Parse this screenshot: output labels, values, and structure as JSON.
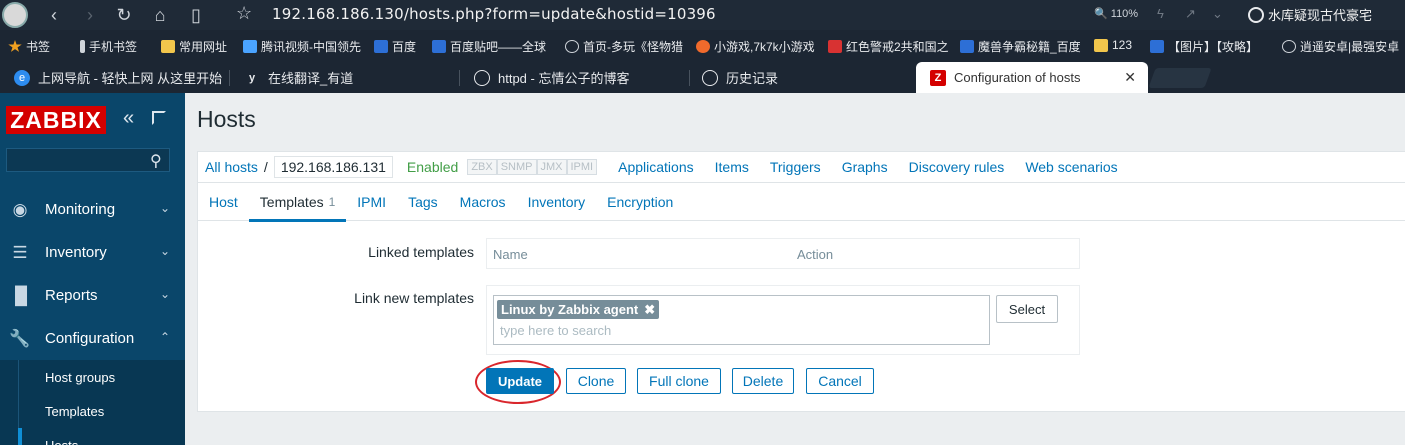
{
  "browser": {
    "url": "192.168.186.130/hosts.php?form=update&hostid=10396",
    "zoom": "110%",
    "search_engine_label": "水库疑现古代豪宅",
    "icons": [
      "avatar",
      "back-icon",
      "forward-icon",
      "reload-icon",
      "home-icon",
      "reader-icon",
      "bookmark-star-icon"
    ]
  },
  "bookmarks": [
    {
      "label": "书签",
      "color": "#f0a020"
    },
    {
      "label": "手机书签",
      "color": "#cfd4da"
    },
    {
      "label": "常用网址",
      "color": "#f2c64c"
    },
    {
      "label": "腾讯视频-中国领先",
      "color": "#4aa3ff"
    },
    {
      "label": "百度",
      "color": "#2d6fd6"
    },
    {
      "label": "百度贴吧——全球",
      "color": "#2d6fd6"
    },
    {
      "label": "首页-多玩《怪物猎",
      "color": "#cfd4da"
    },
    {
      "label": "小游戏,7k7k小游戏",
      "color": "#f06a2c"
    },
    {
      "label": "红色警戒2共和国之",
      "color": "#d83232"
    },
    {
      "label": "魔兽争霸秘籍_百度",
      "color": "#2d6fd6"
    },
    {
      "label": "123",
      "color": "#f2c64c"
    },
    {
      "label": "【图片】【攻略】",
      "color": "#2d6fd6"
    },
    {
      "label": "逍遥安卓|最强安卓",
      "color": "#cfd4da"
    }
  ],
  "tabs": [
    {
      "label": "上网导航 - 轻快上网 从这里开始"
    },
    {
      "label": "在线翻译_有道"
    },
    {
      "label": "httpd - 忘情公子的博客"
    },
    {
      "label": "历史记录"
    },
    {
      "label": "Configuration of hosts",
      "close": "✕"
    }
  ],
  "sidebar": {
    "logo": "ZABBIX",
    "menu": [
      {
        "label": "Monitoring",
        "icon": "eye-icon"
      },
      {
        "label": "Inventory",
        "icon": "list-icon"
      },
      {
        "label": "Reports",
        "icon": "bar-chart-icon"
      },
      {
        "label": "Configuration",
        "icon": "wrench-icon"
      }
    ],
    "config_sub": [
      {
        "label": "Host groups"
      },
      {
        "label": "Templates"
      },
      {
        "label": "Hosts"
      }
    ]
  },
  "page": {
    "title": "Hosts"
  },
  "host_nav": {
    "all_hosts": "All hosts",
    "separator": "/",
    "current_host": "192.168.186.131",
    "status": "Enabled",
    "availability": [
      "ZBX",
      "SNMP",
      "JMX",
      "IPMI"
    ],
    "links": [
      "Applications",
      "Items",
      "Triggers",
      "Graphs",
      "Discovery rules",
      "Web scenarios"
    ]
  },
  "form_tabs": [
    {
      "label": "Host"
    },
    {
      "label": "Templates",
      "count": "1"
    },
    {
      "label": "IPMI"
    },
    {
      "label": "Tags"
    },
    {
      "label": "Macros"
    },
    {
      "label": "Inventory"
    },
    {
      "label": "Encryption"
    }
  ],
  "templates_form": {
    "linked_label": "Linked templates",
    "col_name": "Name",
    "col_action": "Action",
    "link_new_label": "Link new templates",
    "selected_chip": "Linux by Zabbix agent",
    "chip_remove": "✖",
    "search_placeholder": "type here to search",
    "select_button": "Select"
  },
  "buttons": {
    "update": "Update",
    "clone": "Clone",
    "full_clone": "Full clone",
    "delete": "Delete",
    "cancel": "Cancel"
  },
  "annotation": {
    "highlight_color": "#d9262c"
  }
}
